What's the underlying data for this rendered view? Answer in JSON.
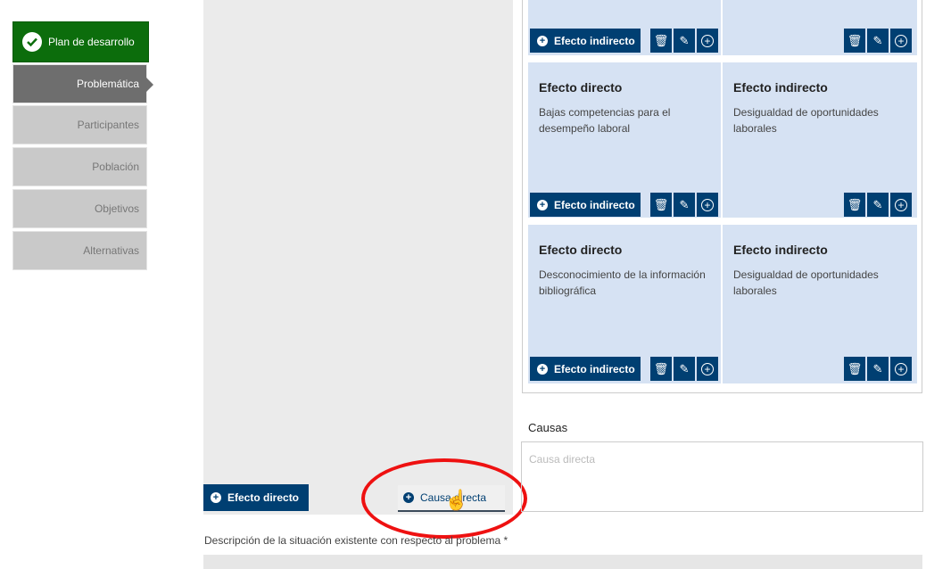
{
  "sidebar": {
    "plan": "Plan de desarrollo",
    "items": [
      {
        "label": "Problemática",
        "active": true
      },
      {
        "label": "Participantes",
        "active": false
      },
      {
        "label": "Población",
        "active": false
      },
      {
        "label": "Objetivos",
        "active": false
      },
      {
        "label": "Alternativas",
        "active": false
      }
    ]
  },
  "left_panel": {
    "efecto_directo_button": "Efecto directo",
    "causa_directa_button": "Causa directa"
  },
  "cards": {
    "indirect_button": "Efecto indirecto",
    "row2_left": {
      "title": "Efecto directo",
      "desc": "Bajas competencias para el desempeño laboral"
    },
    "row2_right": {
      "title": "Efecto indirecto",
      "desc": "Desigualdad de oportunidades laborales"
    },
    "row3_left": {
      "title": "Efecto directo",
      "desc": "Desconocimiento de la información bibliográfica"
    },
    "row3_right": {
      "title": "Efecto indirecto",
      "desc": "Desigualdad de oportunidades laborales"
    }
  },
  "causas": {
    "label": "Causas",
    "placeholder": "Causa directa"
  },
  "description": {
    "label": "Descripción de la situación existente con respecto al problema *"
  },
  "icons": {
    "check": "check-icon",
    "trash": "trash-icon",
    "pencil": "pencil-icon",
    "add": "plus-circle-icon",
    "cursor": "hand-cursor-icon"
  },
  "colors": {
    "brand_green": "#0c6d0c",
    "brand_blue": "#003f72",
    "card_bg": "#d6e2f3",
    "highlight_red": "#e11111"
  }
}
